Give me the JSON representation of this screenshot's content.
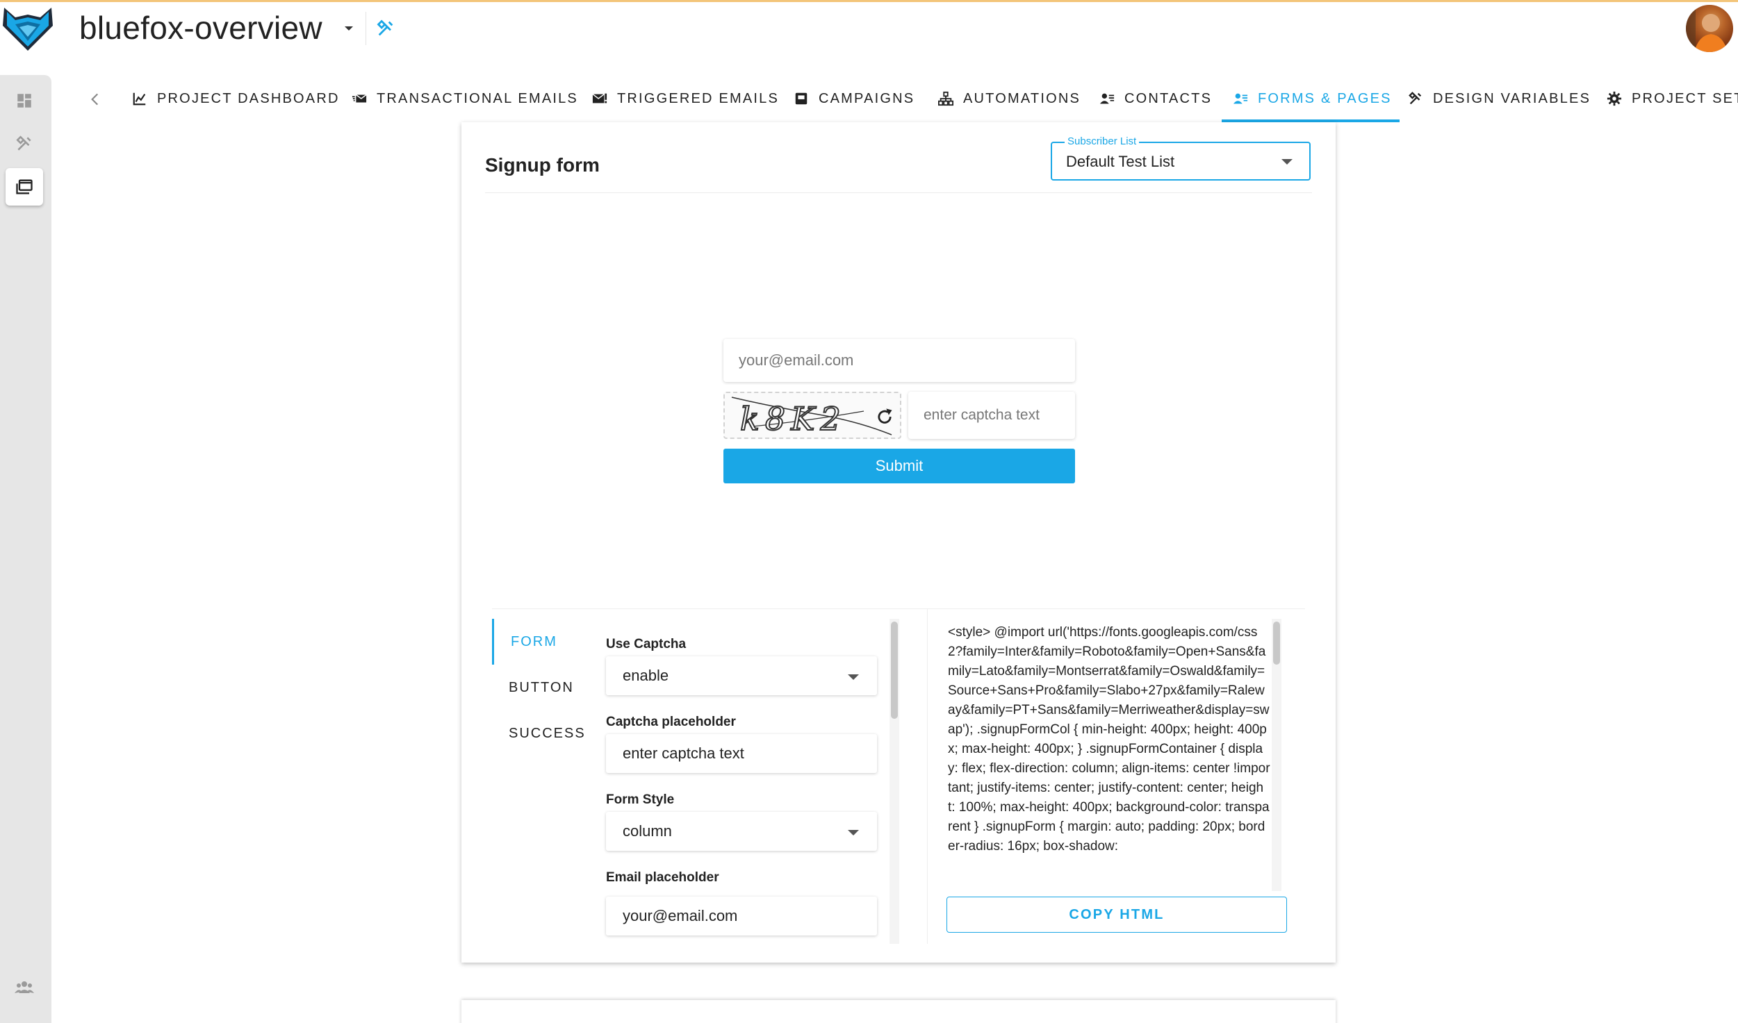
{
  "header": {
    "project_name": "bluefox-overview"
  },
  "tabs": [
    {
      "label": "PROJECT DASHBOARD",
      "icon": "chart-icon"
    },
    {
      "label": "TRANSACTIONAL EMAILS",
      "icon": "mail-fast-icon"
    },
    {
      "label": "TRIGGERED EMAILS",
      "icon": "mail-alert-icon"
    },
    {
      "label": "CAMPAIGNS",
      "icon": "mailbox-icon"
    },
    {
      "label": "AUTOMATIONS",
      "icon": "sitemap-icon"
    },
    {
      "label": "CONTACTS",
      "icon": "contacts-icon"
    },
    {
      "label": "FORMS & PAGES",
      "icon": "form-icon",
      "active": true
    },
    {
      "label": "DESIGN VARIABLES",
      "icon": "design-tools-icon"
    },
    {
      "label": "PROJECT SETTINGS",
      "icon": "gear-icon"
    }
  ],
  "card": {
    "title": "Signup form",
    "subscriber_list": {
      "label": "Subscriber List",
      "value": "Default Test List"
    }
  },
  "preview": {
    "email_placeholder": "your@email.com",
    "captcha_code": "k8K2",
    "captcha_placeholder": "enter captcha text",
    "submit_label": "Submit"
  },
  "editor": {
    "vtabs": [
      "FORM",
      "BUTTON",
      "SUCCESS"
    ],
    "fields": [
      {
        "label": "Use Captcha",
        "value": "enable",
        "type": "select"
      },
      {
        "label": "Captcha placeholder",
        "value": "enter captcha text",
        "type": "text"
      },
      {
        "label": "Form Style",
        "value": "column",
        "type": "select"
      },
      {
        "label": "Email placeholder",
        "value": "your@email.com",
        "type": "text"
      }
    ],
    "code": "<style> @import url('https://fonts.googleapis.com/css2?family=Inter&family=Roboto&family=Open+Sans&family=Lato&family=Montserrat&family=Oswald&family=Source+Sans+Pro&family=Slabo+27px&family=Raleway&family=PT+Sans&family=Merriweather&display=swap'); .signupFormCol { min-height: 400px; height: 400px; max-height: 400px; } .signupFormContainer { display: flex; flex-direction: column; align-items: center !important; justify-items: center; justify-content: center; height: 100%; max-height: 400px; background-color: transparent } .signupForm { margin: auto; padding: 20px; border-radius: 16px; box-shadow:",
    "copy_label": "COPY HTML"
  },
  "colors": {
    "accent": "#1aa7e6",
    "rail": "#e6e6e6",
    "top_border": "#f3c57a"
  }
}
